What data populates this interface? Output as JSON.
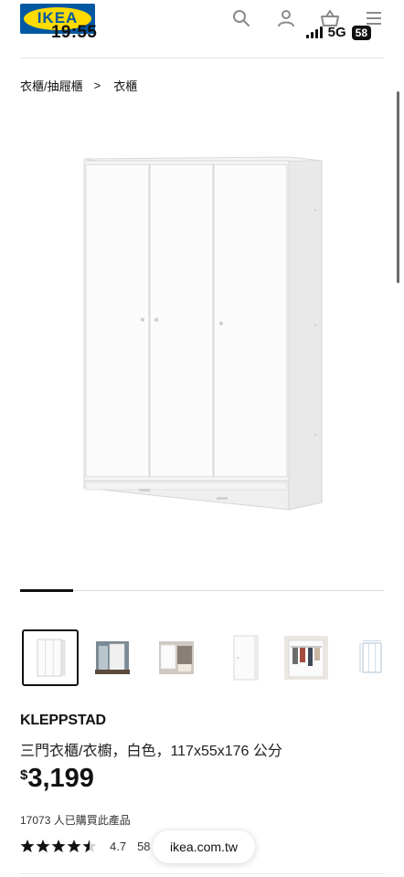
{
  "status_bar": {
    "time": "19:55",
    "network": "5G",
    "battery": "58"
  },
  "header": {
    "logo_text": "IKEA",
    "icons": [
      "search-icon",
      "user-icon",
      "cart-icon",
      "menu-icon"
    ]
  },
  "breadcrumb": {
    "items": [
      "衣櫃/抽屜櫃",
      "衣櫃"
    ],
    "separator": ">"
  },
  "gallery": {
    "active_index": 0,
    "total_images": 6,
    "thumbnails": [
      "wardrobe-front",
      "room-scene-1",
      "room-scene-2",
      "wardrobe-side",
      "interior-open",
      "dimension-drawing"
    ]
  },
  "product": {
    "name": "KLEPPSTAD",
    "description": "三門衣櫃/衣櫥，白色，117x55x176 公分",
    "currency_symbol": "$",
    "price": "3,199",
    "purchased_text": "17073 人已購買此產品",
    "rating_value": "4.7",
    "rating_count": "58",
    "rating_stars": 4.5
  },
  "browser": {
    "url": "ikea.com.tw"
  },
  "colors": {
    "brand_blue": "#0058a3",
    "brand_yellow": "#ffdb00",
    "icon_gray": "#8a8a8a"
  }
}
